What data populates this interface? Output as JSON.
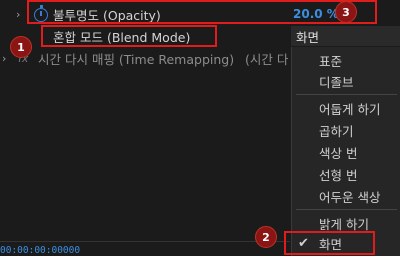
{
  "properties": {
    "opacity": {
      "label": "불투명도 (Opacity)",
      "value": "20.0 %"
    },
    "blend_mode": {
      "label": "혼합 모드 (Blend Mode)"
    },
    "time_remap": {
      "label": "시간 다시 매핑 (Time Remapping)",
      "suffix": "(시간 다"
    }
  },
  "timecode": "00:00:00:00000",
  "dropdown": {
    "current": "화면",
    "items": [
      "표준",
      "디졸브",
      "어둡게 하기",
      "곱하기",
      "색상 번",
      "선형 번",
      "어두운 색상",
      "밝게 하기",
      "화면"
    ],
    "selected_index": 8
  },
  "annotations": {
    "badge_1": "1",
    "badge_2": "2",
    "badge_3": "3"
  },
  "colors": {
    "accent": "#3b8fe0",
    "highlight": "#e01c1c",
    "badge": "#8b1515"
  }
}
